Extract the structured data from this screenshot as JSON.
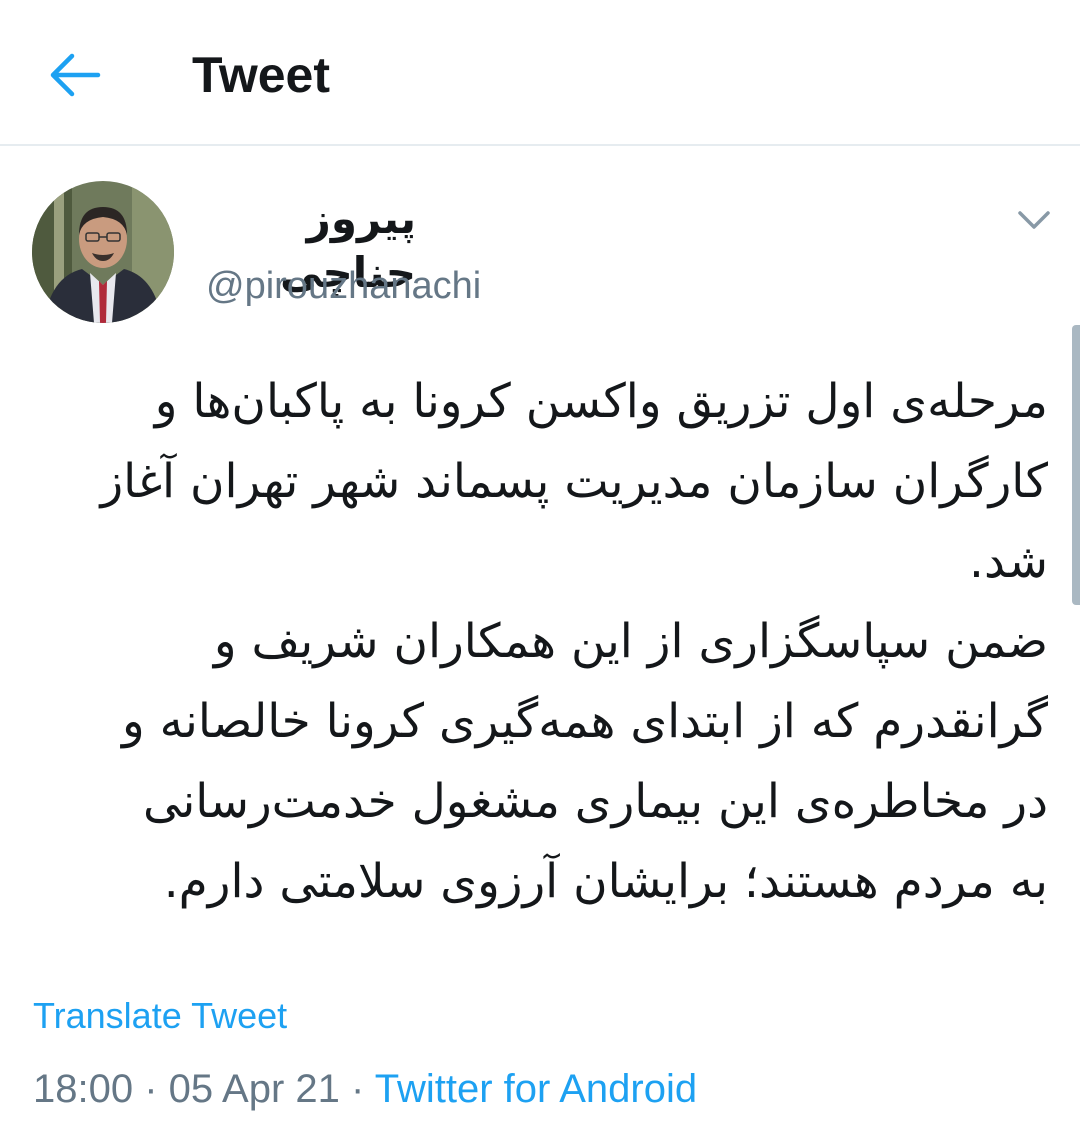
{
  "header": {
    "title": "Tweet",
    "back_icon": "arrow-left-icon",
    "accent_color": "#1da1f2"
  },
  "author": {
    "display_name": "پیروز حناچی",
    "handle": "@pirouzhanachi",
    "more_icon": "chevron-down-icon"
  },
  "tweet": {
    "paragraph_1": "مرحله‌ی اول تزریق واکسن کرونا به پاکبان‌ها و\nکارگران سازمان مدیریت پسماند شهر تهران آغاز\nشد.",
    "paragraph_2": " ضمن سپاسگزاری از این همکاران شریف و\nگرانقدرم که از ابتدای همه‌گیری کرونا خالصانه و\nدر مخاطره‌ی این بیماری مشغول خدمت‌رسانی\nبه مردم هستند؛ برایشان آرزوی سلامتی دارم.",
    "translate_label": "Translate Tweet"
  },
  "meta": {
    "time": "18:00",
    "separator": " · ",
    "date": "05 Apr 21",
    "source": "Twitter for Android"
  }
}
